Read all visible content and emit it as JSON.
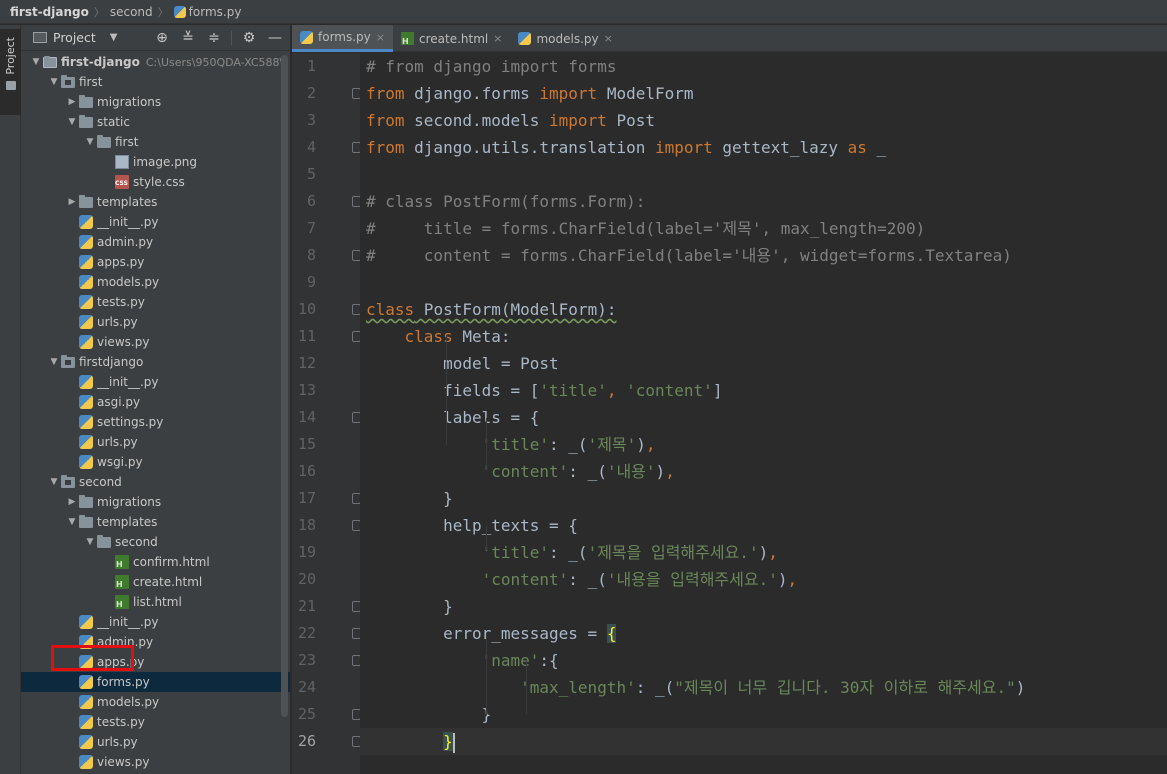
{
  "breadcrumb": {
    "items": [
      "first-django",
      "second",
      "forms.py"
    ]
  },
  "toolstrip": {
    "tab_label": "Project"
  },
  "project_panel": {
    "title": "Project",
    "actions": [
      "locate-icon",
      "expand-all-icon",
      "collapse-all-icon",
      "gear-icon",
      "minimize-icon"
    ],
    "tree": [
      {
        "label": "first-django",
        "hint": "C:\\Users\\950QDA-XC588\\",
        "depth": 0,
        "kind": "root",
        "expanded": true
      },
      {
        "label": "first",
        "depth": 1,
        "kind": "module",
        "expanded": true
      },
      {
        "label": "migrations",
        "depth": 2,
        "kind": "folder",
        "expanded": false
      },
      {
        "label": "static",
        "depth": 2,
        "kind": "folder",
        "expanded": true
      },
      {
        "label": "first",
        "depth": 3,
        "kind": "folder",
        "expanded": true
      },
      {
        "label": "image.png",
        "depth": 4,
        "kind": "img"
      },
      {
        "label": "style.css",
        "depth": 4,
        "kind": "css"
      },
      {
        "label": "templates",
        "depth": 2,
        "kind": "folder",
        "expanded": false
      },
      {
        "label": "__init__.py",
        "depth": 2,
        "kind": "py"
      },
      {
        "label": "admin.py",
        "depth": 2,
        "kind": "py"
      },
      {
        "label": "apps.py",
        "depth": 2,
        "kind": "py"
      },
      {
        "label": "models.py",
        "depth": 2,
        "kind": "py"
      },
      {
        "label": "tests.py",
        "depth": 2,
        "kind": "py"
      },
      {
        "label": "urls.py",
        "depth": 2,
        "kind": "py"
      },
      {
        "label": "views.py",
        "depth": 2,
        "kind": "py"
      },
      {
        "label": "firstdjango",
        "depth": 1,
        "kind": "module",
        "expanded": true
      },
      {
        "label": "__init__.py",
        "depth": 2,
        "kind": "py"
      },
      {
        "label": "asgi.py",
        "depth": 2,
        "kind": "py"
      },
      {
        "label": "settings.py",
        "depth": 2,
        "kind": "py"
      },
      {
        "label": "urls.py",
        "depth": 2,
        "kind": "py"
      },
      {
        "label": "wsgi.py",
        "depth": 2,
        "kind": "py"
      },
      {
        "label": "second",
        "depth": 1,
        "kind": "module",
        "expanded": true
      },
      {
        "label": "migrations",
        "depth": 2,
        "kind": "folder",
        "expanded": false
      },
      {
        "label": "templates",
        "depth": 2,
        "kind": "folder",
        "expanded": true
      },
      {
        "label": "second",
        "depth": 3,
        "kind": "folder",
        "expanded": true
      },
      {
        "label": "confirm.html",
        "depth": 4,
        "kind": "html"
      },
      {
        "label": "create.html",
        "depth": 4,
        "kind": "html"
      },
      {
        "label": "list.html",
        "depth": 4,
        "kind": "html"
      },
      {
        "label": "__init__.py",
        "depth": 2,
        "kind": "py"
      },
      {
        "label": "admin.py",
        "depth": 2,
        "kind": "py"
      },
      {
        "label": "apps.py",
        "depth": 2,
        "kind": "py"
      },
      {
        "label": "forms.py",
        "depth": 2,
        "kind": "py",
        "selected": true
      },
      {
        "label": "models.py",
        "depth": 2,
        "kind": "py"
      },
      {
        "label": "tests.py",
        "depth": 2,
        "kind": "py"
      },
      {
        "label": "urls.py",
        "depth": 2,
        "kind": "py"
      },
      {
        "label": "views.py",
        "depth": 2,
        "kind": "py"
      }
    ]
  },
  "editor": {
    "tabs": [
      {
        "label": "forms.py",
        "kind": "py",
        "active": true
      },
      {
        "label": "create.html",
        "kind": "html",
        "active": false
      },
      {
        "label": "models.py",
        "kind": "py",
        "active": false
      }
    ],
    "current_line": 26,
    "lines": [
      [
        [
          "cm",
          "# from django import forms"
        ]
      ],
      [
        [
          "kw",
          "from"
        ],
        [
          "t",
          " django.forms "
        ],
        [
          "kw",
          "import"
        ],
        [
          "t",
          " ModelForm"
        ]
      ],
      [
        [
          "kw",
          "from"
        ],
        [
          "t",
          " second.models "
        ],
        [
          "kw",
          "import"
        ],
        [
          "t",
          " Post"
        ]
      ],
      [
        [
          "kw",
          "from"
        ],
        [
          "t",
          " django.utils.translation "
        ],
        [
          "kw",
          "import"
        ],
        [
          "t",
          " gettext_lazy "
        ],
        [
          "kw",
          "as"
        ],
        [
          "t",
          " _"
        ]
      ],
      [],
      [
        [
          "cm",
          "# class PostForm(forms.Form):"
        ]
      ],
      [
        [
          "cm",
          "#     title = forms.CharField(label='제목', max_length=200)"
        ]
      ],
      [
        [
          "cm",
          "#     content = forms.CharField(label='내용', widget=forms.Textarea)"
        ]
      ],
      [],
      [
        [
          "kw",
          "class"
        ],
        [
          "t",
          " PostForm(ModelForm):"
        ]
      ],
      [
        [
          "t",
          "    "
        ],
        [
          "kw",
          "class"
        ],
        [
          "t",
          " Meta:"
        ]
      ],
      [
        [
          "t",
          "        model = Post"
        ]
      ],
      [
        [
          "t",
          "        fields = ["
        ],
        [
          "str",
          "'title'"
        ],
        [
          "kw",
          ","
        ],
        [
          "t",
          " "
        ],
        [
          "str",
          "'content'"
        ],
        [
          "t",
          "]"
        ]
      ],
      [
        [
          "t",
          "        labels = {"
        ]
      ],
      [
        [
          "t",
          "            "
        ],
        [
          "str",
          "'title'"
        ],
        [
          "t",
          ": _("
        ],
        [
          "str",
          "'제목'"
        ],
        [
          "t",
          ")"
        ],
        [
          "kw",
          ","
        ]
      ],
      [
        [
          "t",
          "            "
        ],
        [
          "str",
          "'content'"
        ],
        [
          "t",
          ": _("
        ],
        [
          "str",
          "'내용'"
        ],
        [
          "t",
          ")"
        ],
        [
          "kw",
          ","
        ]
      ],
      [
        [
          "t",
          "        }"
        ]
      ],
      [
        [
          "t",
          "        help_texts = {"
        ]
      ],
      [
        [
          "t",
          "            "
        ],
        [
          "str",
          "'title'"
        ],
        [
          "t",
          ": _("
        ],
        [
          "str",
          "'제목을 입력해주세요.'"
        ],
        [
          "t",
          ")"
        ],
        [
          "kw",
          ","
        ]
      ],
      [
        [
          "t",
          "            "
        ],
        [
          "str",
          "'content'"
        ],
        [
          "t",
          ": _("
        ],
        [
          "str",
          "'내용을 입력해주세요.'"
        ],
        [
          "t",
          ")"
        ],
        [
          "kw",
          ","
        ]
      ],
      [
        [
          "t",
          "        }"
        ]
      ],
      [
        [
          "t",
          "        error_messages = "
        ],
        [
          "brace",
          "{"
        ]
      ],
      [
        [
          "t",
          "            "
        ],
        [
          "str",
          "'name'"
        ],
        [
          "t",
          ":{"
        ]
      ],
      [
        [
          "t",
          "                "
        ],
        [
          "str",
          "'max_length'"
        ],
        [
          "t",
          ": _("
        ],
        [
          "str",
          "\"제목이 너무 깁니다. 30자 이하로 해주세요.\""
        ],
        [
          "t",
          ")"
        ]
      ],
      [
        [
          "t",
          "            }"
        ]
      ],
      [
        [
          "t",
          "        "
        ],
        [
          "brace",
          "}"
        ],
        [
          "caret",
          ""
        ]
      ]
    ]
  }
}
